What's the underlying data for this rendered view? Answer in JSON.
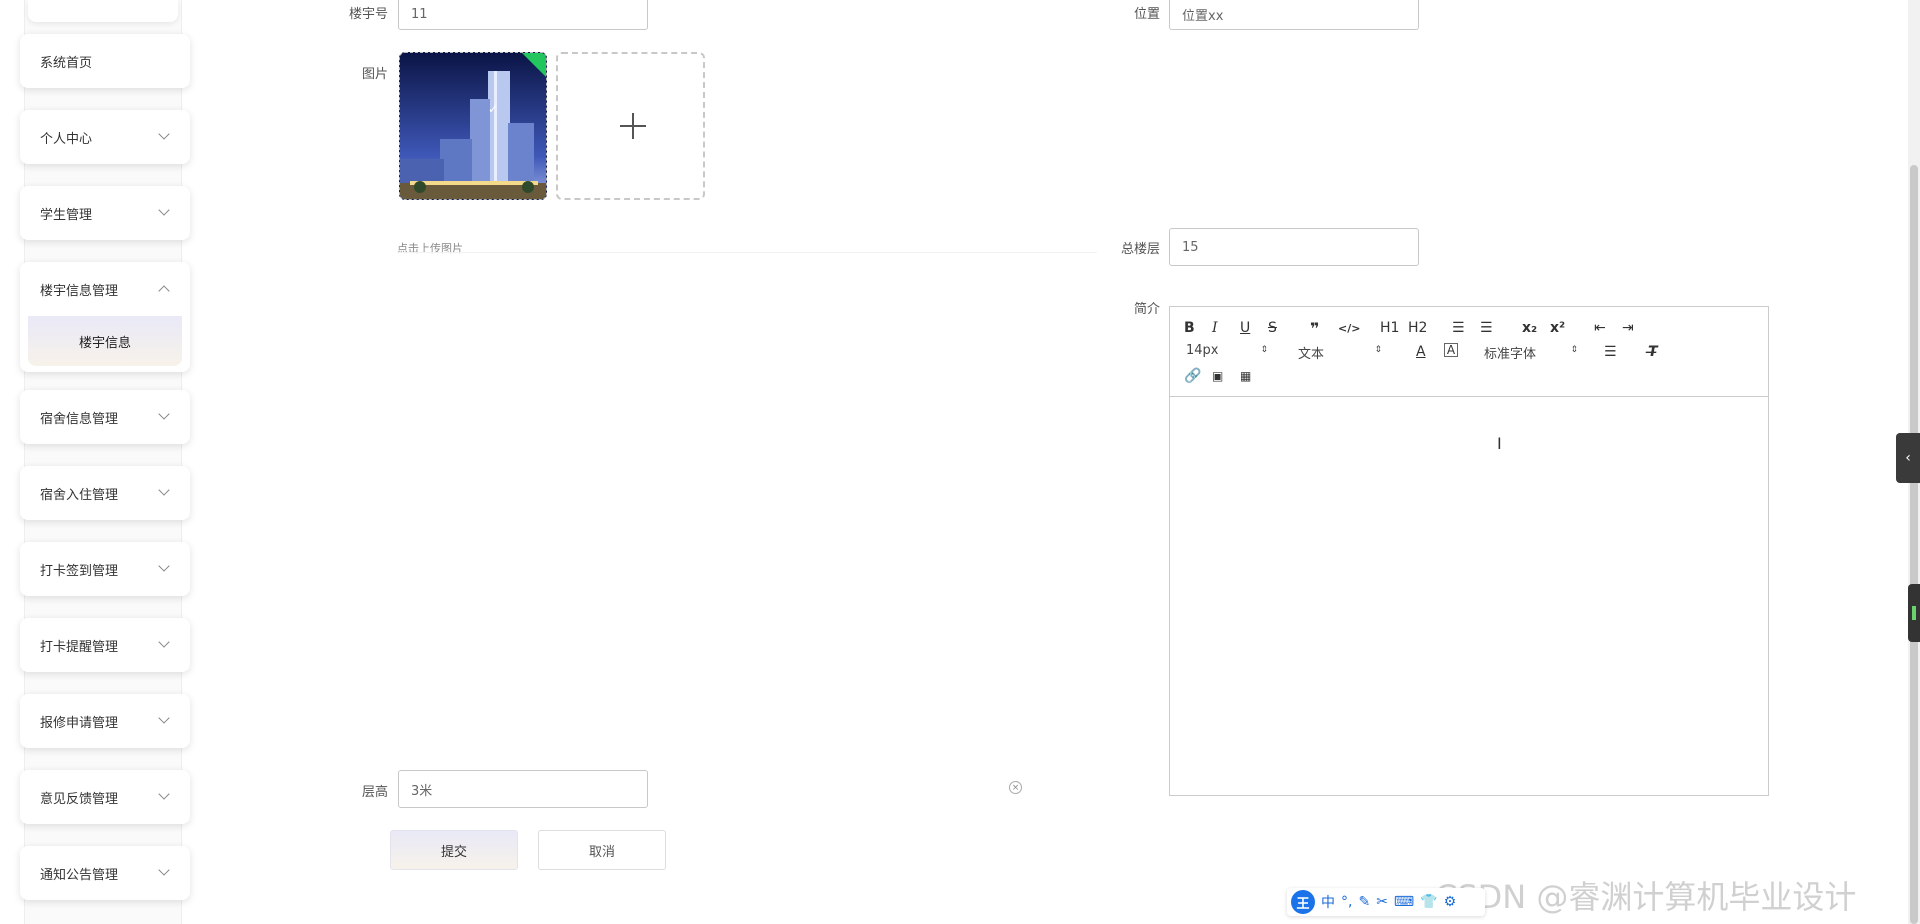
{
  "sidebar": {
    "items": [
      {
        "label": "系统首页"
      },
      {
        "label": "个人中心"
      },
      {
        "label": "学生管理"
      },
      {
        "label": "楼宇信息管理",
        "sub": "楼宇信息"
      },
      {
        "label": "宿舍信息管理"
      },
      {
        "label": "宿舍入住管理"
      },
      {
        "label": "打卡签到管理"
      },
      {
        "label": "打卡提醒管理"
      },
      {
        "label": "报修申请管理"
      },
      {
        "label": "意见反馈管理"
      },
      {
        "label": "通知公告管理"
      }
    ]
  },
  "form": {
    "building_no": {
      "label": "楼宇号",
      "value": "11"
    },
    "location": {
      "label": "位置",
      "value": "位置xx"
    },
    "image": {
      "label": "图片",
      "hint": "点击上传图片"
    },
    "total_floors": {
      "label": "总楼层",
      "value": "15"
    },
    "intro": {
      "label": "简介"
    },
    "floor_height": {
      "label": "层高",
      "value": "3米"
    },
    "submit_label": "提交",
    "cancel_label": "取消"
  },
  "editor": {
    "font_size": "14px",
    "header_select": "文本",
    "font_family": "标准字体",
    "buttons": {
      "bold": "B",
      "italic": "I",
      "underline": "U",
      "strike": "S",
      "h1": "H1",
      "h2": "H2",
      "sub": "x₂",
      "sup": "x²"
    }
  },
  "ime": {
    "logo": "王",
    "mode": "中"
  },
  "watermark": "CSDN @睿渊计算机毕业设计",
  "colors": {
    "accent_gradient_start": "#e9e9f7",
    "accent_gradient_end": "#f7f2ea",
    "check_green": "#22c55e"
  }
}
